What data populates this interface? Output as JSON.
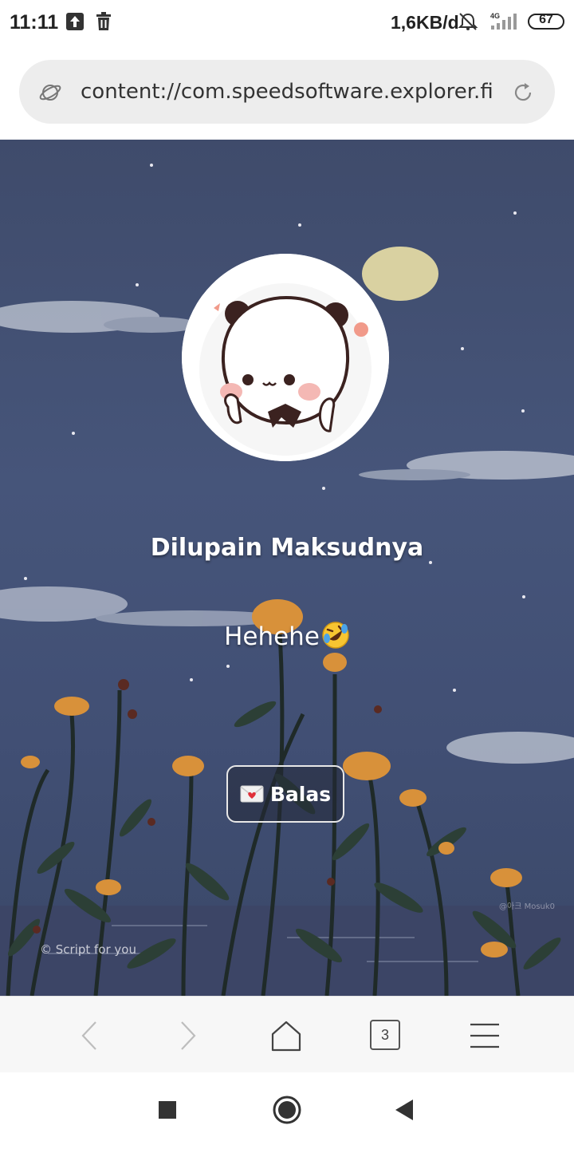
{
  "status_bar": {
    "time": "11:11",
    "network_speed": "1,6KB/d",
    "signal_type": "4G",
    "battery": "67",
    "icons": [
      "upload-icon",
      "trash-icon",
      "muted-alarm-icon",
      "signal-icon",
      "battery-icon"
    ]
  },
  "address_bar": {
    "url": "content://com.speedsoftware.explorer.fi",
    "left_icon": "planet-icon",
    "right_icon": "reload-icon"
  },
  "page": {
    "title": "Dilupain Maksudnya",
    "message": "Hehehe",
    "message_emoji": "rofl-emoji-icon",
    "reply_button": {
      "label": "Balas",
      "icon": "love-letter-icon"
    },
    "credit": "© Script for you",
    "watermark": "@아크 Mosuk0"
  },
  "toolbar": {
    "back_icon": "chevron-left-icon",
    "forward_icon": "chevron-right-icon",
    "home_icon": "home-icon",
    "tab_count": "3",
    "menu_icon": "menu-icon"
  },
  "navbar": {
    "icons": [
      "recents-square-icon",
      "home-circle-icon",
      "back-triangle-icon"
    ]
  },
  "colors": {
    "sky": "#45547a",
    "flower": "#e09a3a",
    "toolbar_bg": "#f7f7f7",
    "address_bg": "#ededed"
  }
}
